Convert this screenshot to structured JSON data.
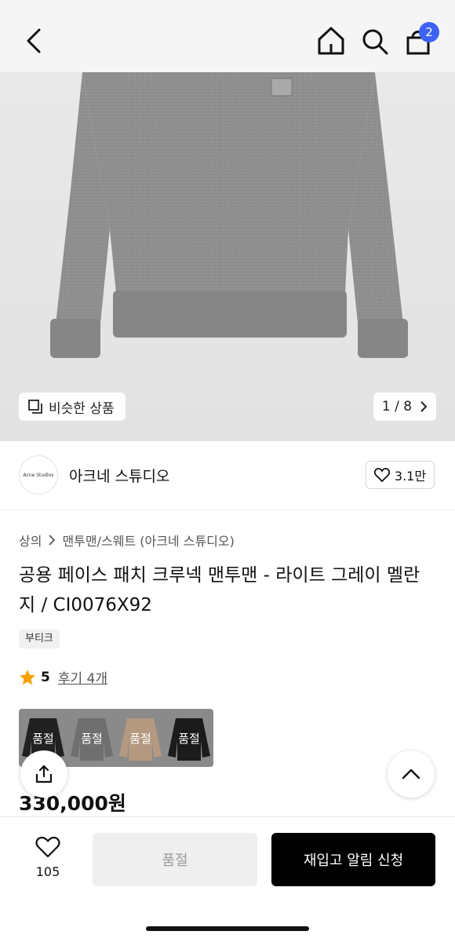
{
  "topnav": {
    "cart_count": "2"
  },
  "hero": {
    "similar_label": "비슷한 상품",
    "pager": "1 / 8"
  },
  "brand": {
    "logo_text": "Acne Studios",
    "name": "아크네 스튜디오",
    "likes": "3.1만"
  },
  "product": {
    "breadcrumb": [
      "상의",
      "맨투맨/스웨트 (아크네 스튜디오)"
    ],
    "title": "공용 페이스 패치 크루넥 맨투맨 - 라이트 그레이 멜란지 / CI0076X92",
    "tag": "부티크",
    "rating": "5",
    "reviews": "후기 4개",
    "price": "330,000원"
  },
  "options": [
    {
      "label": "품절",
      "color": "#1c1c1c"
    },
    {
      "label": "품절",
      "color": "#6e6e6e"
    },
    {
      "label": "품절",
      "color": "#b79a80"
    },
    {
      "label": "품절",
      "color": "#161616"
    }
  ],
  "bottom": {
    "wish_count": "105",
    "soldout_label": "품절",
    "restock_label": "재입고 알림 신청"
  },
  "colors": {
    "accent": "#3d62f5",
    "star": "#f3a200",
    "sweater": "#8e8e8e"
  }
}
